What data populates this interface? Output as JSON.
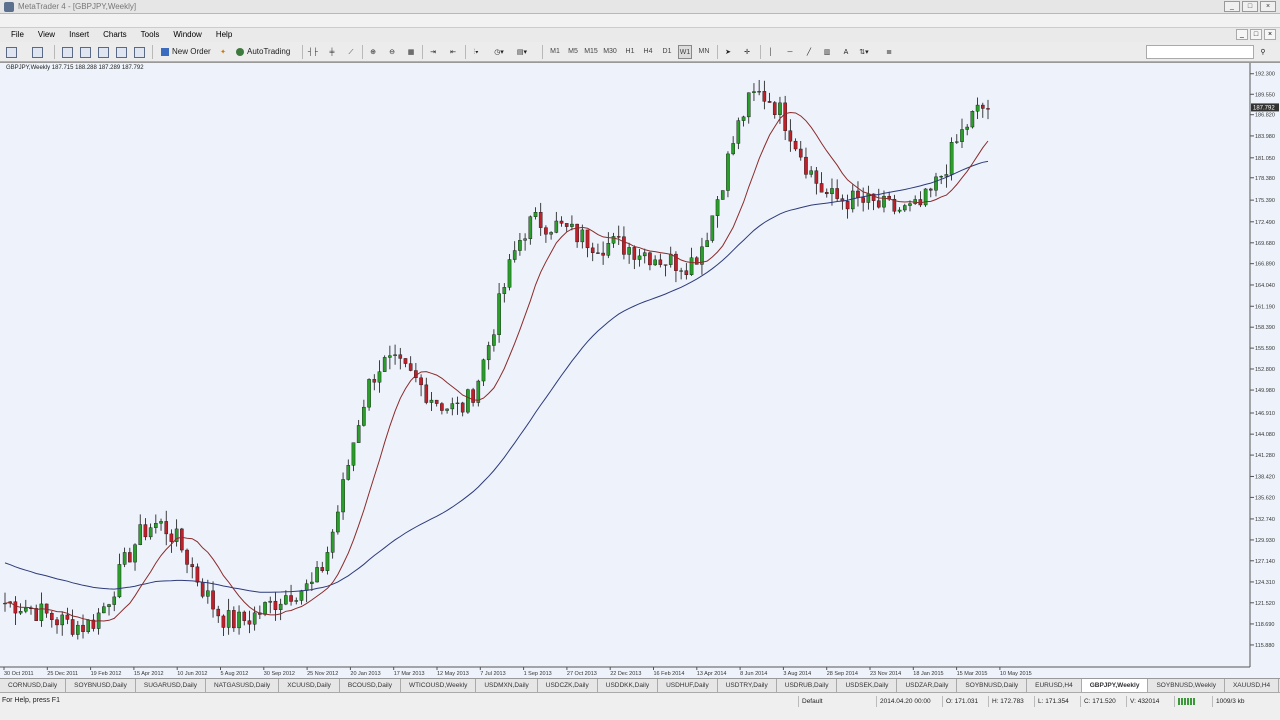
{
  "window": {
    "title": "MetaTrader 4 - [GBPJPY,Weekly]",
    "buttons": [
      "_",
      "□",
      "×"
    ]
  },
  "menu": {
    "items": [
      "File",
      "View",
      "Insert",
      "Charts",
      "Tools",
      "Window",
      "Help"
    ],
    "mdi_buttons": [
      "_",
      "□",
      "×"
    ]
  },
  "toolbar": {
    "new_order_label": "New Order",
    "autotrading_label": "AutoTrading",
    "timeframes": [
      "M1",
      "M5",
      "M15",
      "M30",
      "H1",
      "H4",
      "D1",
      "W1",
      "MN"
    ]
  },
  "chart": {
    "header": "GBPJPY,Weekly  187.715 188.288 187.289 187.792",
    "current_price_label": "187.792",
    "colors": {
      "bull": "#2a9e2a",
      "bear": "#c0202a",
      "ma_fast": "#8b2b2b",
      "ma_slow": "#2c3a7a",
      "bg": "#eef3fb"
    }
  },
  "chart_data": {
    "type": "candlestick",
    "title": "GBPJPY,Weekly",
    "x_ticks": [
      "30 Oct 2011",
      "25 Dec 2011",
      "19 Feb 2012",
      "15 Apr 2012",
      "10 Jun 2012",
      "5 Aug 2012",
      "30 Sep 2012",
      "25 Nov 2012",
      "20 Jan 2013",
      "17 Mar 2013",
      "12 May 2013",
      "7 Jul 2013",
      "1 Sep 2013",
      "27 Oct 2013",
      "22 Dec 2013",
      "16 Feb 2014",
      "13 Apr 2014",
      "8 Jun 2014",
      "3 Aug 2014",
      "28 Sep 2014",
      "23 Nov 2014",
      "18 Jan 2015",
      "15 Mar 2015",
      "10 May 2015"
    ],
    "y_ticks": [
      "192.300",
      "189.550",
      "186.820",
      "183.980",
      "181.050",
      "178.380",
      "175.390",
      "172.490",
      "169.680",
      "166.890",
      "164.040",
      "161.190",
      "158.390",
      "155.590",
      "152.800",
      "149.980",
      "146.910",
      "144.080",
      "141.280",
      "138.420",
      "135.620",
      "132.740",
      "129.930",
      "127.140",
      "124.310",
      "121.520",
      "118.690",
      "115.880"
    ],
    "ylim": [
      114.0,
      193.2
    ],
    "key_levels": [
      {
        "date": "Oct 2011",
        "price": 121.5
      },
      {
        "date": "Jan 2012",
        "price": 118.5
      },
      {
        "date": "Mar 2012",
        "price": 132.0
      },
      {
        "date": "Jun 2012",
        "price": 119.0
      },
      {
        "date": "Sep 2012",
        "price": 123.5
      },
      {
        "date": "Mar 2013",
        "price": 153.5
      },
      {
        "date": "Jul 2013",
        "price": 147.5
      },
      {
        "date": "Oct 2013",
        "price": 172.5
      },
      {
        "date": "Apr 2014",
        "price": 169.5
      },
      {
        "date": "Sep 2014",
        "price": 167.0
      },
      {
        "date": "Dec 2014",
        "price": 189.5
      },
      {
        "date": "Jan 2015",
        "price": 175.5
      },
      {
        "date": "Mar 2015",
        "price": 174.0
      },
      {
        "date": "May 2015",
        "price": 187.8
      }
    ],
    "series": [
      {
        "type": "candlestick"
      },
      {
        "type": "moving-average",
        "color": "#8b2b2b"
      },
      {
        "type": "moving-average",
        "color": "#2c3a7a"
      }
    ],
    "grid": false
  },
  "tabs": [
    "CORNUSD,Daily",
    "SOYBNUSD,Daily",
    "SUGARUSD,Daily",
    "NATGASUSD,Daily",
    "XCUUSD,Daily",
    "BCOUSD,Daily",
    "WTICOUSD,Weekly",
    "USDMXN,Daily",
    "USDCZK,Daily",
    "USDDKK,Daily",
    "USDHUF,Daily",
    "USDTRY,Daily",
    "USDRUB,Daily",
    "USDSEK,Daily",
    "USDZAR,Daily",
    "SOYBNUSD,Daily",
    "EURUSD,H4",
    "GBPJPY,Weekly",
    "SOYBNUSD,Weekly",
    "XAUUSD,H4"
  ],
  "active_tab_index": 17,
  "status": {
    "help": "For Help, press F1",
    "profile": "Default",
    "datetime": "2014.04.20 00:00",
    "open": "O: 171.031",
    "high": "H: 172.783",
    "low": "L: 171.354",
    "close": "C: 171.520",
    "volume": "V: 432014",
    "traffic": "1009/3 kb"
  }
}
